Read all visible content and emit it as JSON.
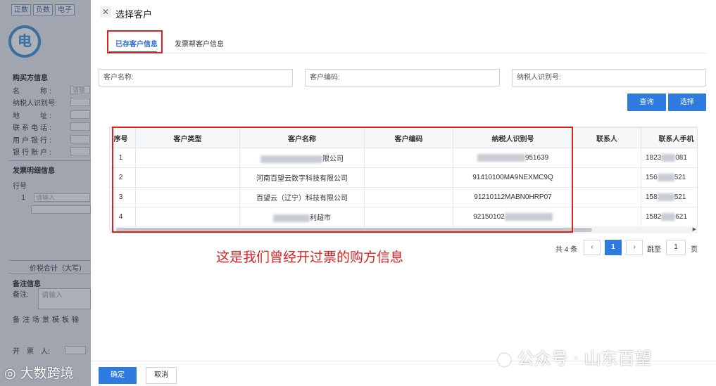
{
  "background_form": {
    "tabs": [
      "正数",
      "负数",
      "电子"
    ],
    "logo_char": "电",
    "buyer_section": "购买方信息",
    "buyer_fields": [
      {
        "label": "名　　称:",
        "placeholder": "请输"
      },
      {
        "label": "纳税人识别号:",
        "placeholder": ""
      },
      {
        "label": "地　　址:",
        "placeholder": ""
      },
      {
        "label": "联系电话:",
        "placeholder": ""
      },
      {
        "label": "用户银行:",
        "placeholder": ""
      },
      {
        "label": "银行账户:",
        "placeholder": ""
      }
    ],
    "detail_section": "发票明细信息",
    "row_no_label": "行号",
    "row_no_value": "1",
    "row_input_placeholder": "请输入",
    "total_label": "价税合计（大写）",
    "remarks_section": "备注信息",
    "remarks_label": "备注:",
    "remarks_placeholder": "请输入",
    "remarks_template": "备注场景模板输",
    "issuer_label": "开　票　人:"
  },
  "modal": {
    "title": "选择客户",
    "tabs": [
      {
        "label": "已存客户信息",
        "active": true
      },
      {
        "label": "发票帮客户信息",
        "active": false
      }
    ],
    "search": {
      "customer_name": "客户名称:",
      "customer_code": "客户编码:",
      "tax_id": "纳税人识别号:"
    },
    "buttons": {
      "query": "查询",
      "select": "选择"
    },
    "table": {
      "columns": [
        "序号",
        "客户类型",
        "客户名称",
        "客户编码",
        "纳税人识别号",
        "联系人",
        "联系人手机"
      ],
      "rows": [
        {
          "no": "1",
          "type": "",
          "name": "限公司",
          "code": "",
          "tax_id": "951639",
          "contact": "",
          "phone_prefix": "1823",
          "phone_suffix": "081"
        },
        {
          "no": "2",
          "type": "",
          "name": "河南百望云数字科技有限公司",
          "code": "",
          "tax_id": "91410100MA9NEXMC9Q",
          "contact": "",
          "phone_prefix": "156",
          "phone_suffix": "521"
        },
        {
          "no": "3",
          "type": "",
          "name": "百望云（辽宁）科技有限公司",
          "code": "",
          "tax_id": "91210112MABN0HRP07",
          "contact": "",
          "phone_prefix": "158",
          "phone_suffix": "521"
        },
        {
          "no": "4",
          "type": "",
          "name": "利超市",
          "code": "",
          "tax_id": "92150102",
          "contact": "",
          "phone_prefix": "1582",
          "phone_suffix": "621"
        }
      ]
    },
    "annotation": "这是我们曾经开过票的购方信息",
    "pagination": {
      "total": "共 4 条",
      "current": "1",
      "jump_label": "跳至",
      "jump_value": "1",
      "page_suffix": "页"
    },
    "footer": {
      "ok": "确定",
      "cancel": "取消"
    }
  },
  "watermarks": {
    "wechat": "公众号 · 山东百望",
    "brand": "大数跨境"
  },
  "colors": {
    "primary": "#2f7ae0",
    "highlight": "#e02020"
  }
}
